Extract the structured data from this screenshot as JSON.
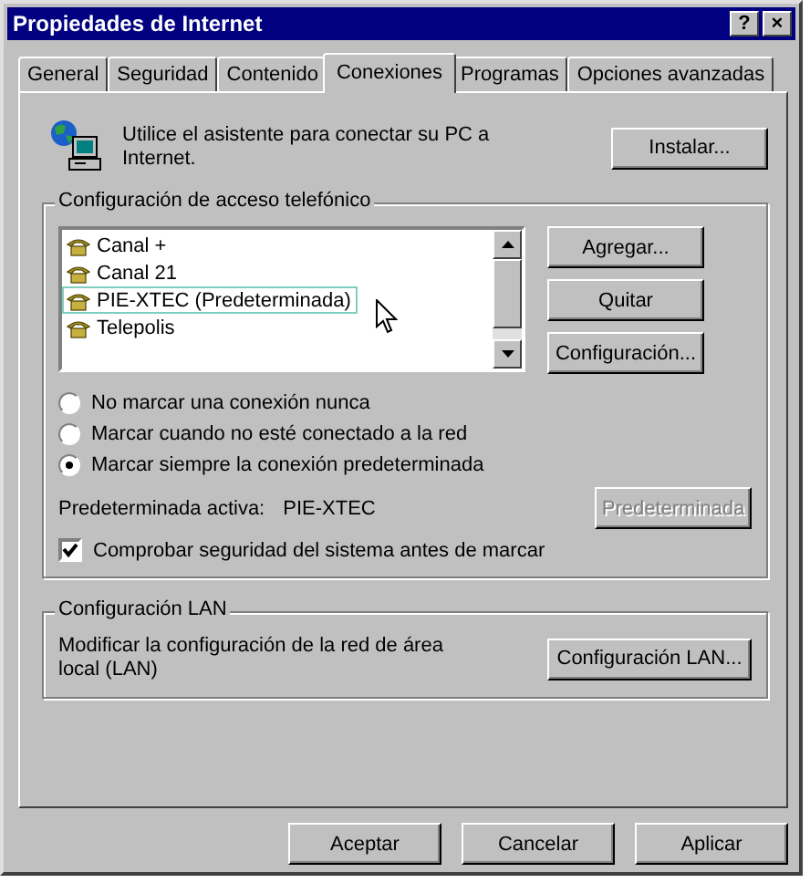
{
  "window": {
    "title": "Propiedades de Internet",
    "controls": [
      "?",
      "×"
    ]
  },
  "tabs": [
    {
      "label": "General",
      "selected": false
    },
    {
      "label": "Seguridad",
      "selected": false
    },
    {
      "label": "Contenido",
      "selected": false
    },
    {
      "label": "Conexiones",
      "selected": true
    },
    {
      "label": "Programas",
      "selected": false
    },
    {
      "label": "Opciones avanzadas",
      "selected": false
    }
  ],
  "wizard": {
    "text": "Utilice el asistente para conectar su PC a Internet.",
    "button": "Instalar..."
  },
  "dialup": {
    "title": "Configuración de acceso telefónico",
    "connections": [
      {
        "name": "Canal +",
        "selected": false
      },
      {
        "name": "Canal 21",
        "selected": false
      },
      {
        "name": "PIE-XTEC (Predeterminada)",
        "selected": true
      },
      {
        "name": "Telepolis",
        "selected": false
      }
    ],
    "buttons": [
      "Agregar...",
      "Quitar",
      "Configuración..."
    ],
    "options": [
      {
        "label": "No marcar una conexión nunca",
        "selected": false
      },
      {
        "label": "Marcar cuando no esté conectado a la red",
        "selected": false
      },
      {
        "label": "Marcar siempre la conexión predeterminada",
        "selected": true
      }
    ],
    "active_label": "Predeterminada activa:",
    "active_value": "PIE-XTEC",
    "default_button": {
      "label": "Predeterminada",
      "disabled": true
    },
    "check": {
      "label": "Comprobar seguridad del sistema antes de marcar",
      "checked": true
    }
  },
  "lan": {
    "title": "Configuración LAN",
    "text": "Modificar la configuración de la red de área local (LAN)",
    "button": "Configuración LAN..."
  },
  "buttons": [
    "Aceptar",
    "Cancelar",
    "Aplicar"
  ]
}
